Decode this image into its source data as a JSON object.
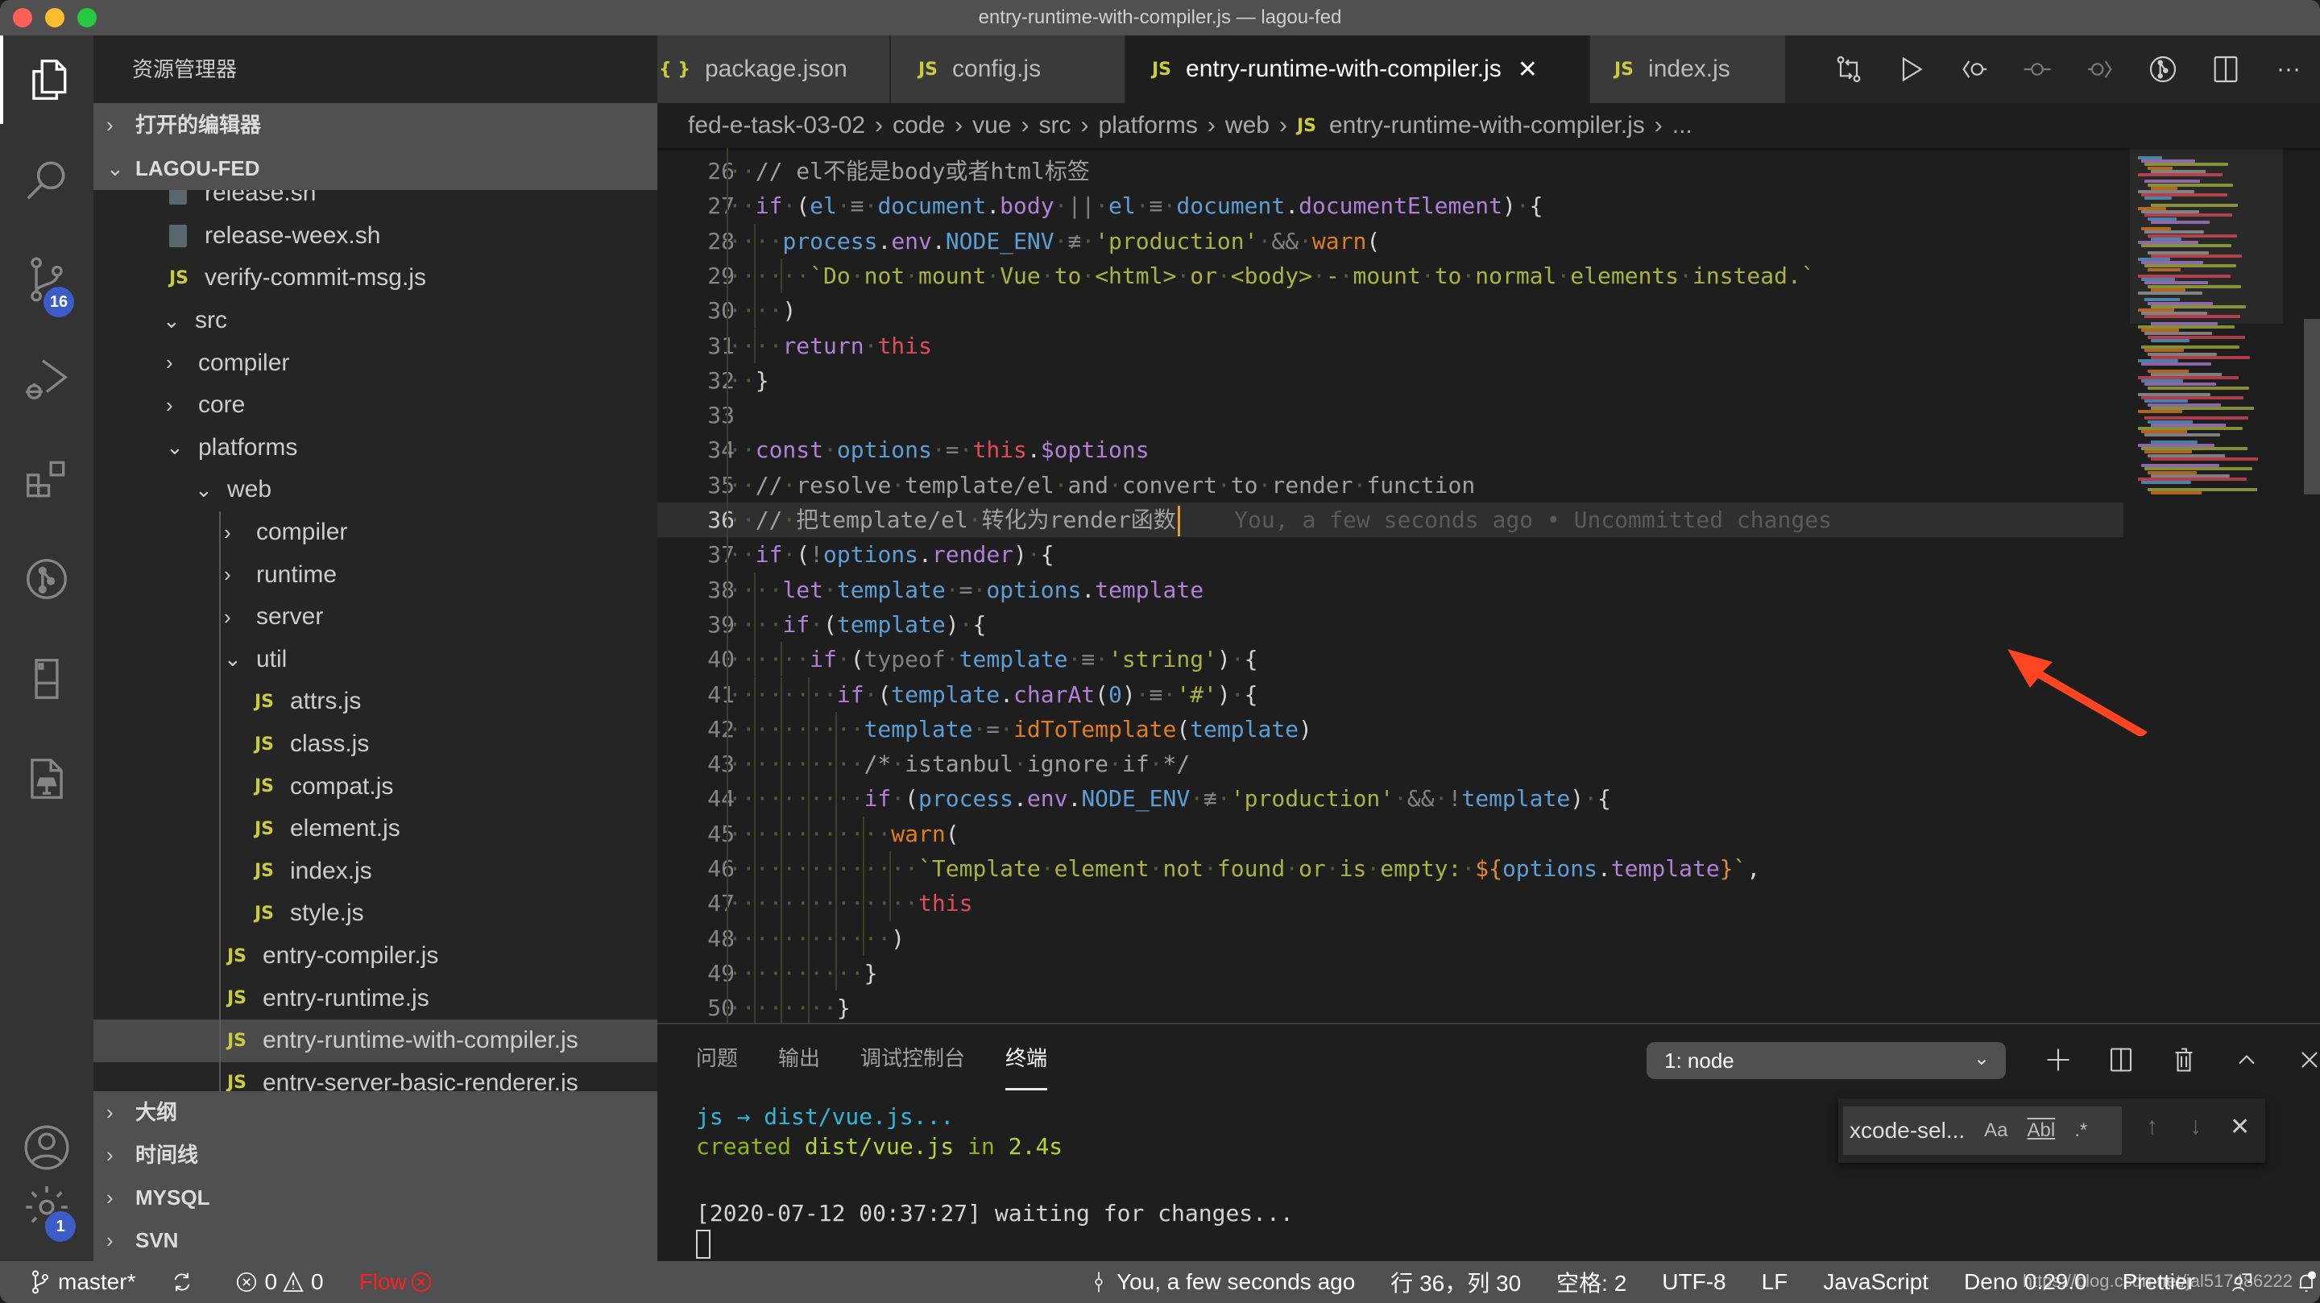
{
  "window": {
    "title": "entry-runtime-with-compiler.js — lagou-fed"
  },
  "activity_bar": {
    "items": [
      {
        "name": "explorer",
        "icon": "files-icon",
        "active": true
      },
      {
        "name": "search",
        "icon": "search-icon"
      },
      {
        "name": "source-control",
        "icon": "source-control-icon",
        "badge": "16"
      },
      {
        "name": "run-debug",
        "icon": "debug-icon"
      },
      {
        "name": "extensions",
        "icon": "extensions-icon"
      },
      {
        "name": "git-graph",
        "icon": "git-graph-icon"
      },
      {
        "name": "remote-explorer",
        "icon": "device-icon"
      },
      {
        "name": "keynote",
        "icon": "document-icon"
      }
    ],
    "bottom": [
      {
        "name": "accounts",
        "icon": "account-icon"
      },
      {
        "name": "manage",
        "icon": "gear-icon",
        "badge": "1"
      }
    ]
  },
  "sidebar": {
    "title": "资源管理器",
    "sections_top": [
      {
        "label": "打开的编辑器",
        "expanded": false
      },
      {
        "label": "LAGOU-FED",
        "expanded": true
      }
    ],
    "tree": [
      {
        "label": "release.sh",
        "type": "sh",
        "level": 3
      },
      {
        "label": "release-weex.sh",
        "type": "sh",
        "level": 3
      },
      {
        "label": "verify-commit-msg.js",
        "type": "js",
        "level": 3
      },
      {
        "label": "src",
        "type": "folder",
        "expanded": true,
        "level": 2
      },
      {
        "label": "compiler",
        "type": "folder",
        "expanded": false,
        "level": 3
      },
      {
        "label": "core",
        "type": "folder",
        "expanded": false,
        "level": 3
      },
      {
        "label": "platforms",
        "type": "folder",
        "expanded": true,
        "level": 3
      },
      {
        "label": "web",
        "type": "folder",
        "expanded": true,
        "level": 4
      },
      {
        "label": "compiler",
        "type": "folder",
        "expanded": false,
        "level": 5
      },
      {
        "label": "runtime",
        "type": "folder",
        "expanded": false,
        "level": 5
      },
      {
        "label": "server",
        "type": "folder",
        "expanded": false,
        "level": 5
      },
      {
        "label": "util",
        "type": "folder",
        "expanded": true,
        "level": 5
      },
      {
        "label": "attrs.js",
        "type": "js",
        "level": 6
      },
      {
        "label": "class.js",
        "type": "js",
        "level": 6
      },
      {
        "label": "compat.js",
        "type": "js",
        "level": 6
      },
      {
        "label": "element.js",
        "type": "js",
        "level": 6
      },
      {
        "label": "index.js",
        "type": "js",
        "level": 6
      },
      {
        "label": "style.js",
        "type": "js",
        "level": 6
      },
      {
        "label": "entry-compiler.js",
        "type": "js",
        "level": 5
      },
      {
        "label": "entry-runtime.js",
        "type": "js",
        "level": 5
      },
      {
        "label": "entry-runtime-with-compiler.js",
        "type": "js",
        "level": 5,
        "selected": true
      },
      {
        "label": "entry-server-basic-renderer.js",
        "type": "js",
        "level": 5
      }
    ],
    "sections_bottom": [
      {
        "label": "大纲"
      },
      {
        "label": "时间线"
      },
      {
        "label": "MYSQL"
      },
      {
        "label": "SVN"
      }
    ]
  },
  "tabs": [
    {
      "label": "package.json",
      "icon": "{ }",
      "active": false
    },
    {
      "label": "config.js",
      "icon": "JS",
      "active": false
    },
    {
      "label": "entry-runtime-with-compiler.js",
      "icon": "JS",
      "active": true,
      "close": "✕"
    },
    {
      "label": "index.js",
      "icon": "JS",
      "active": false
    }
  ],
  "tab_actions": [
    "open-changes-icon",
    "run-icon",
    "previous-change-icon",
    "commit-icon",
    "next-change-icon",
    "git-graph-icon",
    "split-editor-icon",
    "more-actions-icon"
  ],
  "tab_actions_more": "···",
  "breadcrumb": {
    "items": [
      "fed-e-task-03-02",
      "code",
      "vue",
      "src",
      "platforms",
      "web"
    ],
    "file_icon": "JS",
    "file": "entry-runtime-with-compiler.js",
    "tail": "...",
    "separator": "›"
  },
  "editor": {
    "current_line": 36,
    "blame_annotation": "You, a few seconds ago • Uncommitted changes",
    "lines": [
      {
        "n": 26,
        "indent": 1,
        "tokens": [
          [
            "cmt",
            "// el不能是body或者html标签"
          ]
        ]
      },
      {
        "n": 27,
        "indent": 1,
        "tokens": [
          [
            "kw",
            "if"
          ],
          [
            "ws",
            "·"
          ],
          [
            "punc",
            "("
          ],
          [
            "var",
            "el"
          ],
          [
            "ws",
            "·"
          ],
          [
            "op",
            "≡"
          ],
          [
            "ws",
            "·"
          ],
          [
            "var",
            "document"
          ],
          [
            "punc",
            "."
          ],
          [
            "prop",
            "body"
          ],
          [
            "ws",
            "·"
          ],
          [
            "op",
            "||"
          ],
          [
            "ws",
            "·"
          ],
          [
            "var",
            "el"
          ],
          [
            "ws",
            "·"
          ],
          [
            "op",
            "≡"
          ],
          [
            "ws",
            "·"
          ],
          [
            "var",
            "document"
          ],
          [
            "punc",
            "."
          ],
          [
            "prop",
            "documentElement"
          ],
          [
            "punc",
            ")"
          ],
          [
            "ws",
            "·"
          ],
          [
            "punc",
            "{"
          ]
        ]
      },
      {
        "n": 28,
        "indent": 2,
        "tokens": [
          [
            "var",
            "process"
          ],
          [
            "punc",
            "."
          ],
          [
            "prop",
            "env"
          ],
          [
            "punc",
            "."
          ],
          [
            "var",
            "NODE_ENV"
          ],
          [
            "ws",
            "·"
          ],
          [
            "op",
            "≢"
          ],
          [
            "ws",
            "·"
          ],
          [
            "str",
            "'production'"
          ],
          [
            "ws",
            "·"
          ],
          [
            "op",
            "&&"
          ],
          [
            "ws",
            "·"
          ],
          [
            "fn",
            "warn"
          ],
          [
            "punc",
            "("
          ]
        ]
      },
      {
        "n": 29,
        "indent": 3,
        "tokens": [
          [
            "str",
            "`Do·not·mount·Vue·to·<html>·or·<body>·-·mount·to·normal·elements·instead.`"
          ]
        ]
      },
      {
        "n": 30,
        "indent": 2,
        "tokens": [
          [
            "punc",
            ")"
          ]
        ]
      },
      {
        "n": 31,
        "indent": 2,
        "tokens": [
          [
            "kw",
            "return"
          ],
          [
            "ws",
            "·"
          ],
          [
            "this",
            "this"
          ]
        ]
      },
      {
        "n": 32,
        "indent": 1,
        "tokens": [
          [
            "punc",
            "}"
          ]
        ]
      },
      {
        "n": 33,
        "indent": 0,
        "tokens": []
      },
      {
        "n": 34,
        "indent": 1,
        "tokens": [
          [
            "kw",
            "const"
          ],
          [
            "ws",
            "·"
          ],
          [
            "var",
            "options"
          ],
          [
            "ws",
            "·"
          ],
          [
            "op",
            "="
          ],
          [
            "ws",
            "·"
          ],
          [
            "this",
            "this"
          ],
          [
            "punc",
            "."
          ],
          [
            "prop",
            "$options"
          ]
        ]
      },
      {
        "n": 35,
        "indent": 1,
        "tokens": [
          [
            "cmt",
            "//·resolve·template/el·and·convert·to·render·function"
          ]
        ]
      },
      {
        "n": 36,
        "indent": 1,
        "tokens": [
          [
            "cmt",
            "//·把template/el·转化为render函数"
          ]
        ]
      },
      {
        "n": 37,
        "indent": 1,
        "tokens": [
          [
            "kw",
            "if"
          ],
          [
            "ws",
            "·"
          ],
          [
            "punc",
            "("
          ],
          [
            "op",
            "!"
          ],
          [
            "var",
            "options"
          ],
          [
            "punc",
            "."
          ],
          [
            "prop",
            "render"
          ],
          [
            "punc",
            ")"
          ],
          [
            "ws",
            "·"
          ],
          [
            "punc",
            "{"
          ]
        ]
      },
      {
        "n": 38,
        "indent": 2,
        "tokens": [
          [
            "kw",
            "let"
          ],
          [
            "ws",
            "·"
          ],
          [
            "var",
            "template"
          ],
          [
            "ws",
            "·"
          ],
          [
            "op",
            "="
          ],
          [
            "ws",
            "·"
          ],
          [
            "var",
            "options"
          ],
          [
            "punc",
            "."
          ],
          [
            "prop",
            "template"
          ]
        ]
      },
      {
        "n": 39,
        "indent": 2,
        "tokens": [
          [
            "kw",
            "if"
          ],
          [
            "ws",
            "·"
          ],
          [
            "punc",
            "("
          ],
          [
            "var",
            "template"
          ],
          [
            "punc",
            ")"
          ],
          [
            "ws",
            "·"
          ],
          [
            "punc",
            "{"
          ]
        ]
      },
      {
        "n": 40,
        "indent": 3,
        "tokens": [
          [
            "kw",
            "if"
          ],
          [
            "ws",
            "·"
          ],
          [
            "punc",
            "("
          ],
          [
            "op",
            "typeof"
          ],
          [
            "ws",
            "·"
          ],
          [
            "var",
            "template"
          ],
          [
            "ws",
            "·"
          ],
          [
            "op",
            "≡"
          ],
          [
            "ws",
            "·"
          ],
          [
            "str",
            "'string'"
          ],
          [
            "punc",
            ")"
          ],
          [
            "ws",
            "·"
          ],
          [
            "punc",
            "{"
          ]
        ]
      },
      {
        "n": 41,
        "indent": 4,
        "tokens": [
          [
            "kw",
            "if"
          ],
          [
            "ws",
            "·"
          ],
          [
            "punc",
            "("
          ],
          [
            "var",
            "template"
          ],
          [
            "punc",
            "."
          ],
          [
            "prop",
            "charAt"
          ],
          [
            "punc",
            "("
          ],
          [
            "var",
            "0"
          ],
          [
            "punc",
            ")"
          ],
          [
            "ws",
            "·"
          ],
          [
            "op",
            "≡"
          ],
          [
            "ws",
            "·"
          ],
          [
            "str",
            "'#'"
          ],
          [
            "punc",
            ")"
          ],
          [
            "ws",
            "·"
          ],
          [
            "punc",
            "{"
          ]
        ]
      },
      {
        "n": 42,
        "indent": 5,
        "tokens": [
          [
            "var",
            "template"
          ],
          [
            "ws",
            "·"
          ],
          [
            "op",
            "="
          ],
          [
            "ws",
            "·"
          ],
          [
            "fn",
            "idToTemplate"
          ],
          [
            "punc",
            "("
          ],
          [
            "var",
            "template"
          ],
          [
            "punc",
            ")"
          ]
        ]
      },
      {
        "n": 43,
        "indent": 5,
        "tokens": [
          [
            "cmt",
            "/*·istanbul·ignore·if·*/"
          ]
        ]
      },
      {
        "n": 44,
        "indent": 5,
        "tokens": [
          [
            "kw",
            "if"
          ],
          [
            "ws",
            "·"
          ],
          [
            "punc",
            "("
          ],
          [
            "var",
            "process"
          ],
          [
            "punc",
            "."
          ],
          [
            "prop",
            "env"
          ],
          [
            "punc",
            "."
          ],
          [
            "var",
            "NODE_ENV"
          ],
          [
            "ws",
            "·"
          ],
          [
            "op",
            "≢"
          ],
          [
            "ws",
            "·"
          ],
          [
            "str",
            "'production'"
          ],
          [
            "ws",
            "·"
          ],
          [
            "op",
            "&&"
          ],
          [
            "ws",
            "·"
          ],
          [
            "op",
            "!"
          ],
          [
            "var",
            "template"
          ],
          [
            "punc",
            ")"
          ],
          [
            "ws",
            "·"
          ],
          [
            "punc",
            "{"
          ]
        ]
      },
      {
        "n": 45,
        "indent": 6,
        "tokens": [
          [
            "fn",
            "warn"
          ],
          [
            "punc",
            "("
          ]
        ]
      },
      {
        "n": 46,
        "indent": 7,
        "tokens": [
          [
            "str",
            "`Template·element·not·found·or·is·empty:·"
          ],
          [
            "tmpl",
            "${"
          ],
          [
            "var",
            "options"
          ],
          [
            "punc",
            "."
          ],
          [
            "prop",
            "template"
          ],
          [
            "tmpl",
            "}"
          ],
          [
            "str",
            "`"
          ],
          [
            "punc",
            ","
          ]
        ]
      },
      {
        "n": 47,
        "indent": 7,
        "tokens": [
          [
            "this",
            "this"
          ]
        ]
      },
      {
        "n": 48,
        "indent": 6,
        "tokens": [
          [
            "punc",
            ")"
          ]
        ]
      },
      {
        "n": 49,
        "indent": 5,
        "tokens": [
          [
            "punc",
            "}"
          ]
        ]
      },
      {
        "n": 50,
        "indent": 4,
        "tokens": [
          [
            "punc",
            "}"
          ]
        ]
      }
    ],
    "colors": {
      "keyword": "#b180d7",
      "variable": "#5c9fd6",
      "string": "#a8b340",
      "function": "#e07d20",
      "this": "#e04a5a",
      "comment": "#a0a0a0",
      "cursor": "#e0a040",
      "annotation_arrow": "#ff4422"
    }
  },
  "panel": {
    "tabs": [
      {
        "label": "问题",
        "active": false
      },
      {
        "label": "输出",
        "active": false
      },
      {
        "label": "调试控制台",
        "active": false
      },
      {
        "label": "终端",
        "active": true
      }
    ],
    "terminal_select": "1: node",
    "actions": [
      "new-terminal-icon",
      "split-terminal-icon",
      "kill-terminal-icon",
      "maximize-panel-icon",
      "close-panel-icon"
    ],
    "terminal_lines": [
      {
        "parts": [
          [
            "t-cyan",
            "js → dist/vue.js..."
          ]
        ]
      },
      {
        "parts": [
          [
            "t-green",
            "created "
          ],
          [
            "t-greenb",
            "dist/vue.js"
          ],
          [
            "t-green",
            " in "
          ],
          [
            "t-greenb",
            "2.4s"
          ]
        ]
      },
      {
        "parts": [
          [
            "t-white",
            ""
          ]
        ]
      },
      {
        "parts": [
          [
            "t-white",
            "[2020-07-12 00:37:27] waiting for changes..."
          ]
        ]
      }
    ],
    "find": {
      "value": "xcode-sel...",
      "match_case": "Aa",
      "whole_word": "Abl",
      "regex": ".*",
      "prev": "↑",
      "next": "↓",
      "close": "✕"
    }
  },
  "statusbar": {
    "branch": "master*",
    "errors": "0",
    "warnings": "0",
    "flow": "Flow",
    "blame": "You, a few seconds ago",
    "position": "行 36，列 30",
    "indent": "空格: 2",
    "encoding": "UTF-8",
    "eol": "LF",
    "language": "JavaScript",
    "deno": "Deno 0.29.0",
    "prettier": "Prettier",
    "watermark": "https://blog.csdn.net/jal517486222",
    "flow_color": "#ff1f1f"
  }
}
